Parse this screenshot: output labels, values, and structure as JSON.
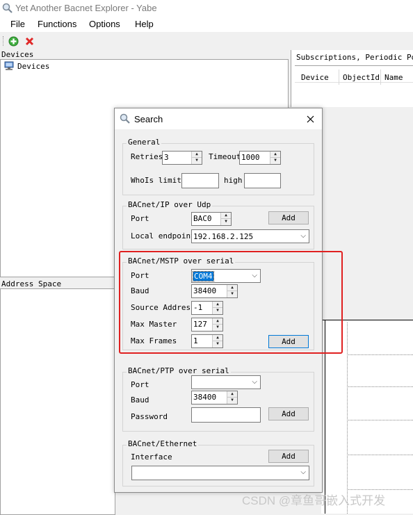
{
  "window": {
    "title": "Yet Another Bacnet Explorer - Yabe"
  },
  "menu": [
    "File",
    "Functions",
    "Options",
    "Help"
  ],
  "toolbar": {
    "add_icon": "green-plus-icon",
    "remove_icon": "red-x-icon"
  },
  "devices_panel": {
    "header": "Devices",
    "tree_root": "Devices"
  },
  "subscriptions_panel": {
    "header": "Subscriptions, Periodic Poll",
    "columns": [
      "Device",
      "ObjectId",
      "Name"
    ]
  },
  "address_space_panel": {
    "header": "Address Space"
  },
  "search_dialog": {
    "title": "Search",
    "general": {
      "title": "General",
      "retries_label": "Retries",
      "retries_value": "3",
      "timeout_label": "Timeout",
      "timeout_value": "1000",
      "whois_label": "WhoIs limit l",
      "whois_low_value": "",
      "high_label": "high",
      "whois_high_value": ""
    },
    "ip": {
      "title": "BACnet/IP over Udp",
      "port_label": "Port",
      "port_value": "BAC0",
      "add_label": "Add",
      "endpoint_label": "Local endpoint",
      "endpoint_value": "192.168.2.125"
    },
    "mstp": {
      "title": "BACnet/MSTP over serial",
      "port_label": "Port",
      "port_value": "COM4",
      "baud_label": "Baud",
      "baud_value": "38400",
      "source_label": "Source Address",
      "source_value": "-1",
      "max_master_label": "Max Master",
      "max_master_value": "127",
      "max_frames_label": "Max Frames",
      "max_frames_value": "1",
      "add_label": "Add"
    },
    "ptp": {
      "title": "BACnet/PTP over serial",
      "port_label": "Port",
      "port_value": "",
      "baud_label": "Baud",
      "baud_value": "38400",
      "password_label": "Password",
      "password_value": "",
      "add_label": "Add"
    },
    "ethernet": {
      "title": "BACnet/Ethernet",
      "interface_label": "Interface",
      "interface_value": "",
      "add_label": "Add"
    }
  },
  "watermark": "CSDN @章鱼哥嵌入式开发",
  "colors": {
    "highlight_frame": "#e02020",
    "selection": "#0078d7"
  }
}
